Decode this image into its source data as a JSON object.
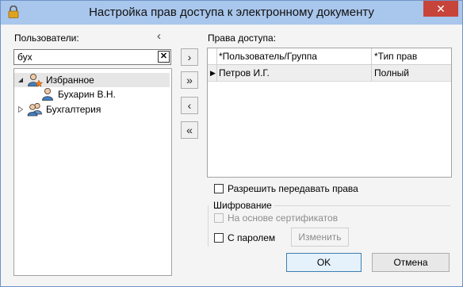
{
  "window": {
    "title": "Настройка прав доступа к электронному документу",
    "close": "✕"
  },
  "users": {
    "label": "Пользователи:",
    "collapse": "‹",
    "search_value": "бух",
    "clear": "✕",
    "tree": [
      {
        "label": "Избранное",
        "expanded": true,
        "selected": true
      },
      {
        "label": "Бухарин В.Н."
      },
      {
        "label": "Бухгалтерия",
        "expanded": false
      }
    ]
  },
  "transfer": {
    "add": "›",
    "add_all": "»",
    "remove": "‹",
    "remove_all": "«"
  },
  "rights": {
    "label": "Права доступа:",
    "columns": [
      "*Пользователь/Группа",
      "*Тип прав"
    ],
    "rows": [
      {
        "marker": "▶",
        "user": "Петров И.Г.",
        "type": "Полный"
      }
    ]
  },
  "allow_transfer": {
    "label": "Разрешить передавать права",
    "checked": false
  },
  "encryption": {
    "title": "Шифрование",
    "by_certificates": "На основе сертификатов",
    "with_password": "С паролем",
    "change": "Изменить"
  },
  "buttons": {
    "ok": "OK",
    "cancel": "Отмена"
  },
  "colors": {
    "titlebar": "#a9c6ec",
    "close": "#c7443a"
  }
}
